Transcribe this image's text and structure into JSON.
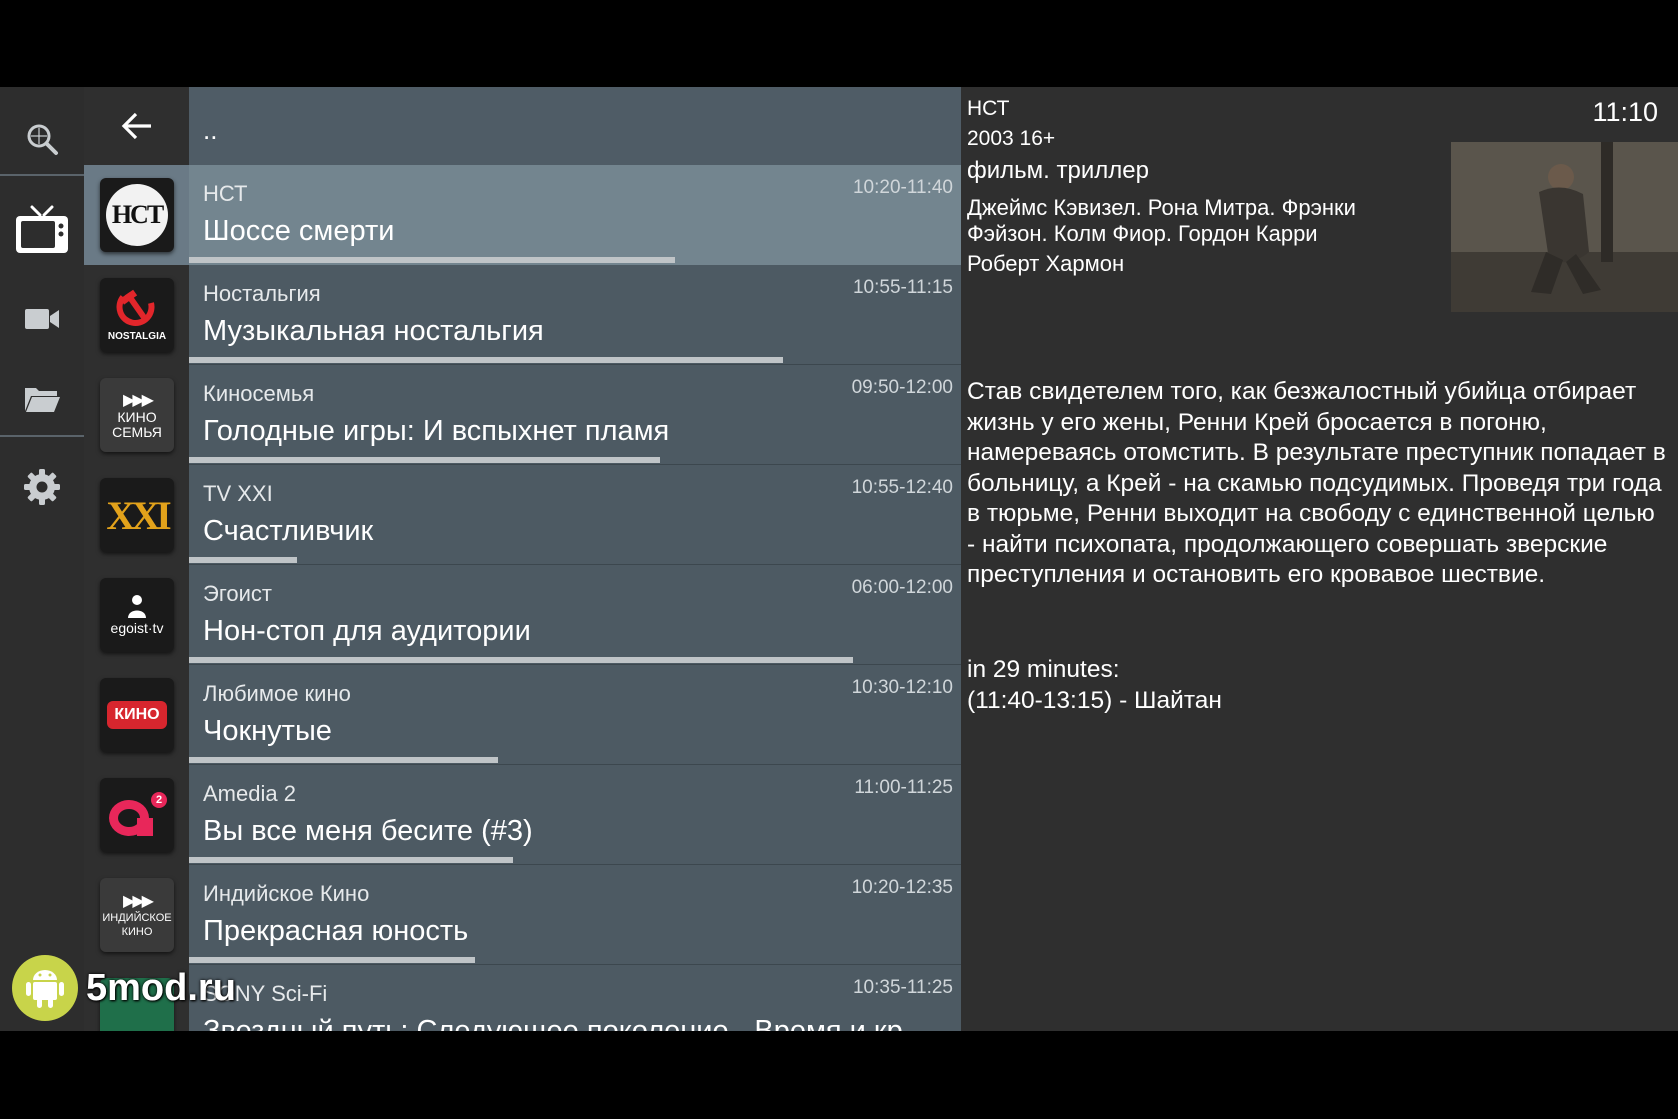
{
  "status": {
    "clock": "11:10"
  },
  "list": {
    "up_label": "..",
    "rows": [
      {
        "channel": "НСТ",
        "program": "Шоссе смерти",
        "time": "10:20-11:40",
        "progress": 0.63,
        "logo": "НСТ",
        "selected": true
      },
      {
        "channel": "Ностальгия",
        "program": "Музыкальная ностальгия",
        "time": "10:55-11:15",
        "progress": 0.77,
        "logo": "NOSTALGIA",
        "selected": false
      },
      {
        "channel": "Киносемья",
        "program": "Голодные игры: И вспыхнет пламя",
        "time": "09:50-12:00",
        "progress": 0.61,
        "logo": "КИНО СЕМЬЯ",
        "selected": false
      },
      {
        "channel": "TV XXI",
        "program": "Счастливчик",
        "time": "10:55-12:40",
        "progress": 0.14,
        "logo": "XXI",
        "selected": false
      },
      {
        "channel": "Эгоист",
        "program": "Нон-стоп для аудитории",
        "time": "06:00-12:00",
        "progress": 0.86,
        "logo": "egoist·tv",
        "selected": false
      },
      {
        "channel": "Любимое кино",
        "program": "Чокнутые",
        "time": "10:30-12:10",
        "progress": 0.4,
        "logo": "КИНО",
        "selected": false
      },
      {
        "channel": "Amedia 2",
        "program": "Вы все меня бесите (#3)",
        "time": "11:00-11:25",
        "progress": 0.42,
        "logo": "a2",
        "selected": false
      },
      {
        "channel": "Индийское Кино",
        "program": "Прекрасная юность",
        "time": "10:20-12:35",
        "progress": 0.37,
        "logo": "ИНДИЙСКОЕ КИНО",
        "selected": false
      },
      {
        "channel": "SONY Sci-Fi",
        "program": "Звездный путь: Следующее поколение - Время и кр",
        "time": "10:35-11:25",
        "progress": 0.0,
        "logo": "SONY",
        "selected": false
      }
    ]
  },
  "detail": {
    "channel": "НСТ",
    "year_rating": "2003 16+",
    "genre": "фильм. триллер",
    "cast_line1": "Джеймс Кэвизел. Рона Митра. Фрэнки",
    "cast_line2": "Фэйзон. Колм Фиор. Гордон Карри",
    "director": "Роберт Хармон",
    "description": "Став свидетелем того, как безжалостный убийца отбирает жизнь у его жены, Ренни Крей бросается в погоню, намереваясь отомстить. В результате преступник попадает в больницу, а Крей - на скамью подсудимых. Проведя три года в тюрьме, Ренни выходит на свободу с единственной целью - найти психопата, продолжающего совершать зверские преступления и остановить его кровавое шествие.",
    "next_label": "in 29 minutes:",
    "next_program": "(11:40-13:15) - Шайтан"
  },
  "watermark": {
    "text": "5mod.ru"
  },
  "icons": [
    "search-icon",
    "tv-icon",
    "video-camera-icon",
    "folder-icon",
    "settings-gear-icon",
    "back-arrow-icon",
    "android-icon"
  ]
}
